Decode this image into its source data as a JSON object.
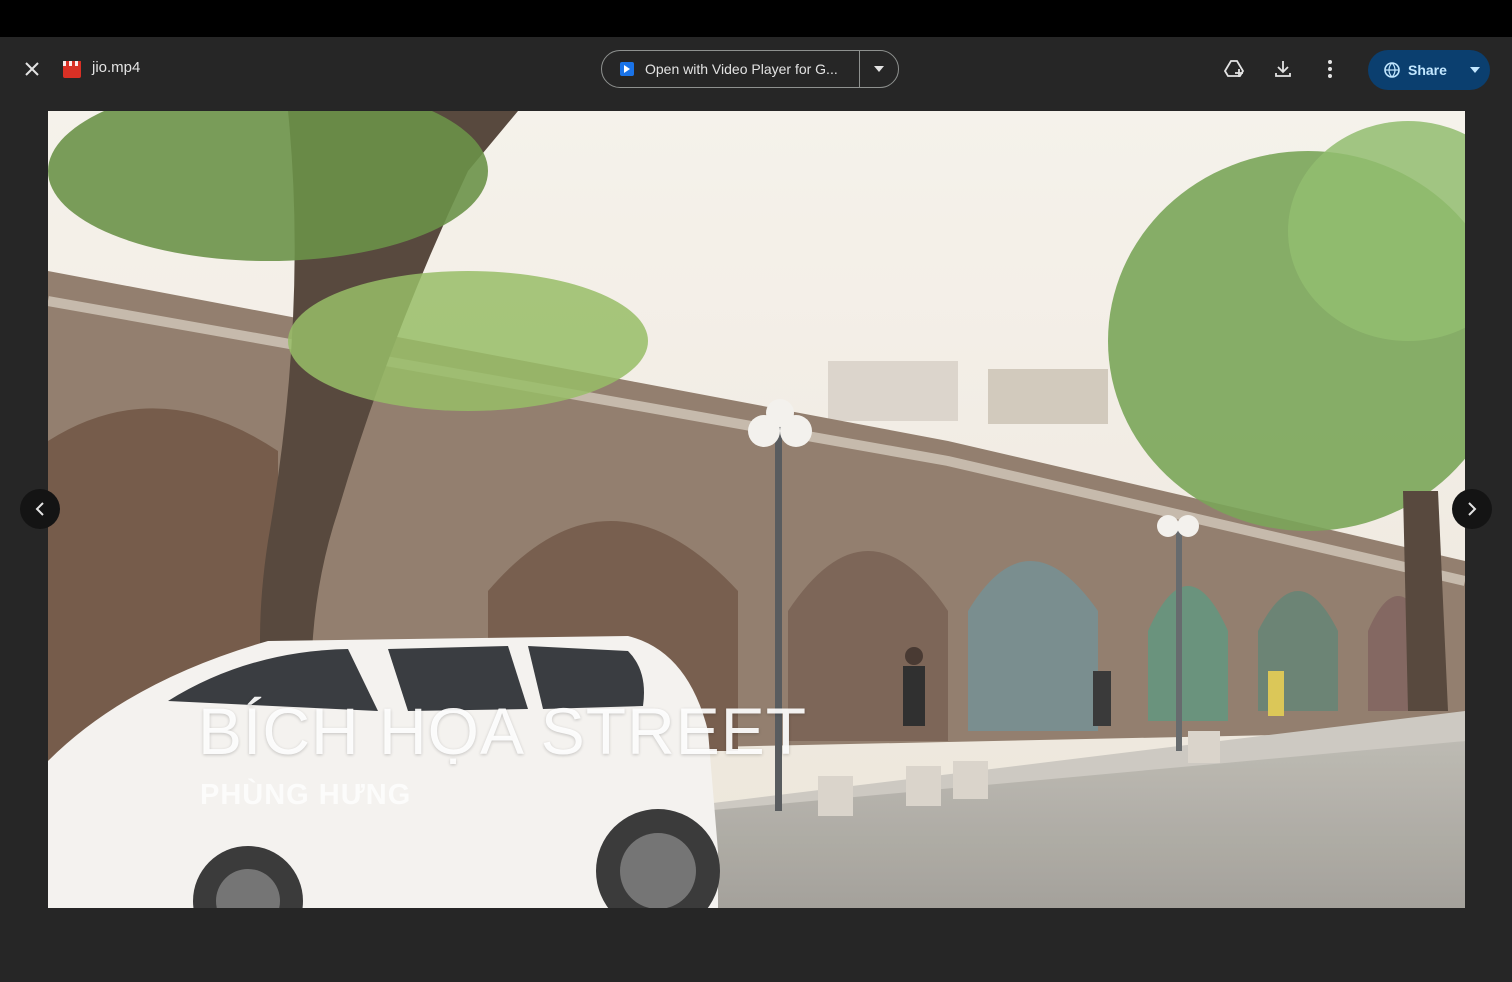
{
  "header": {
    "filename": "jio.mp4",
    "open_with_label": "Open with Video Player for G...",
    "share_label": "Share"
  },
  "icons": {
    "close": "close-icon",
    "file": "video-file-icon",
    "add_to_drive": "add-to-drive-icon",
    "download": "download-icon",
    "more": "more-vert-icon",
    "share": "globe-icon",
    "prev": "chevron-left-icon",
    "next": "chevron-right-icon"
  },
  "video": {
    "title": "BÍCH HỌA STREET",
    "subtitle": "PHÙNG HƯNG"
  },
  "colors": {
    "accent": "#0b3f6f",
    "share_text": "#c2e7ff",
    "file_icon": "#d93025"
  }
}
